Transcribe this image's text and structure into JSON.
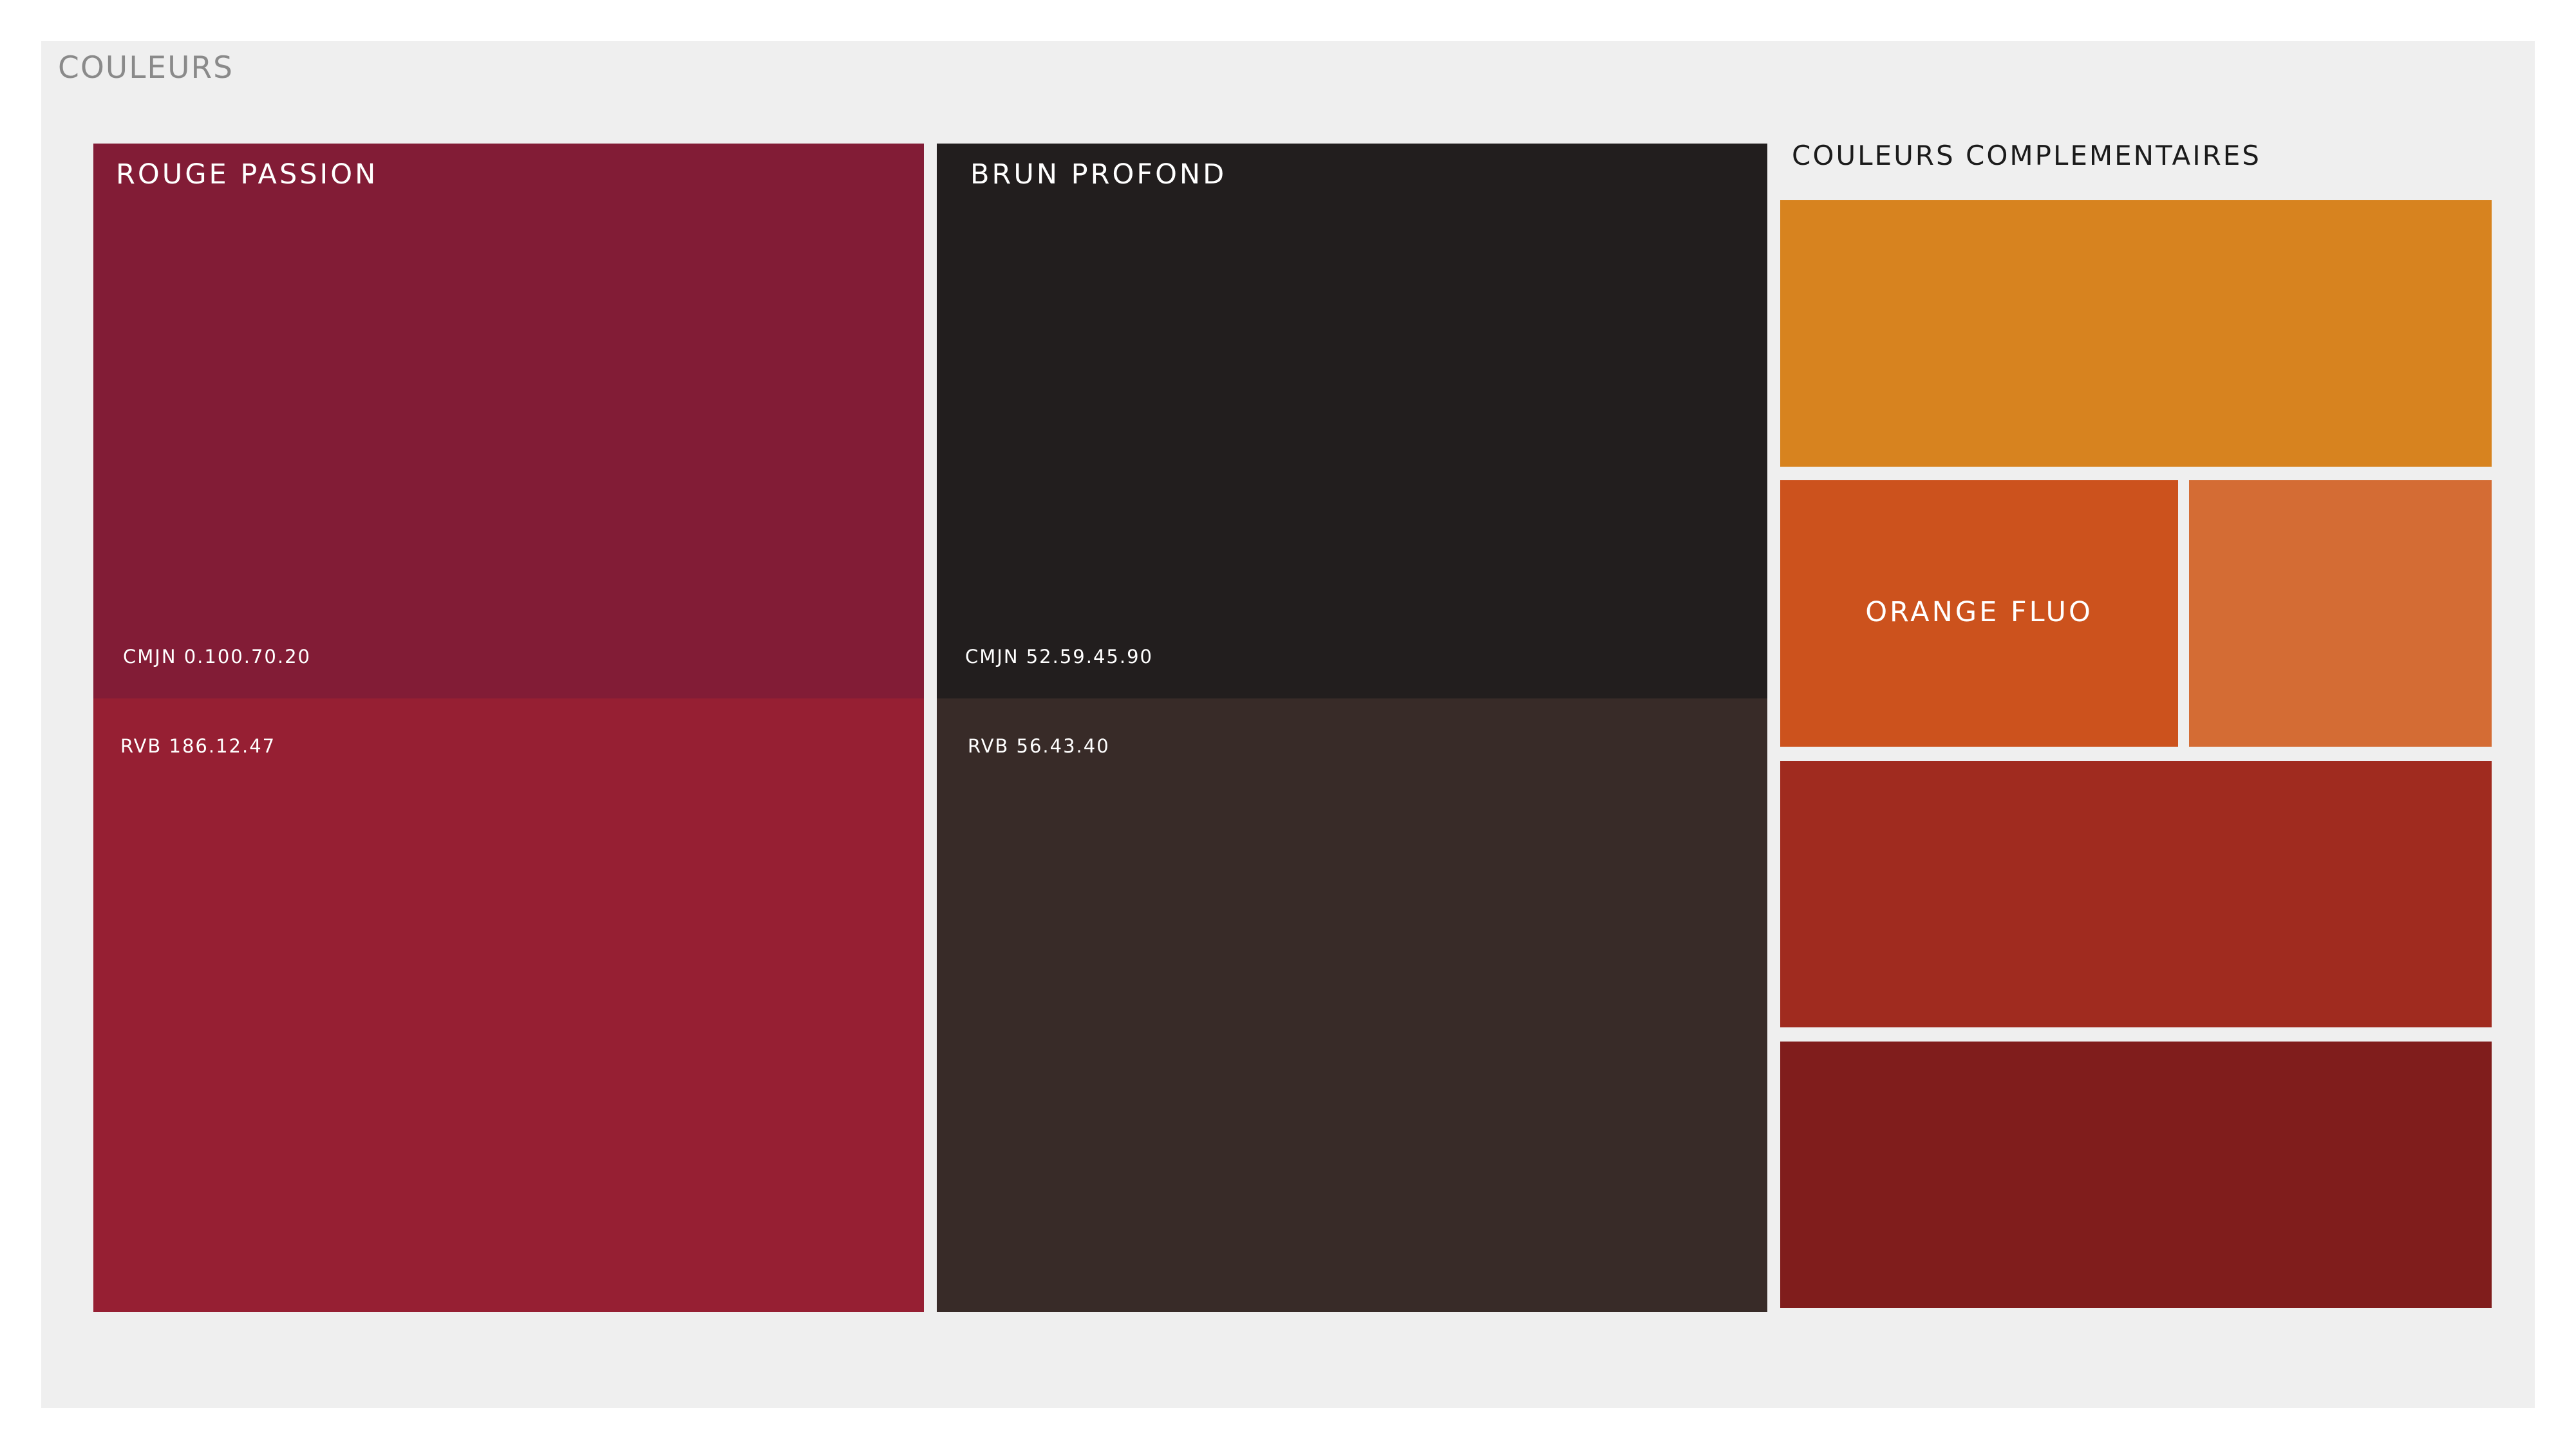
{
  "page": {
    "title": "COULEURS"
  },
  "primary": {
    "rouge": {
      "name": "ROUGE PASSION",
      "cmjn": "CMJN 0.100.70.20",
      "rvb": "RVB 186.12.47",
      "color_top": "#821c36",
      "color_bottom": "#961f33"
    },
    "brun": {
      "name": "BRUN PROFOND",
      "cmjn": "CMJN 52.59.45.90",
      "rvb": "RVB 56.43.40",
      "color_top": "#221e1e",
      "color_bottom": "#382b28"
    }
  },
  "complementary": {
    "title": "COULEURS COMPLEMENTAIRES",
    "orange_fluo_label": "ORANGE FLUO",
    "swatches": [
      {
        "name": "swatch-amber",
        "color": "#d7831f"
      },
      {
        "name": "swatch-orange-fluo",
        "color": "#cc521d"
      },
      {
        "name": "swatch-light-orange",
        "color": "#d46c34"
      },
      {
        "name": "swatch-brick-red",
        "color": "#a02b1f"
      },
      {
        "name": "swatch-dark-red",
        "color": "#801d1c"
      }
    ]
  }
}
